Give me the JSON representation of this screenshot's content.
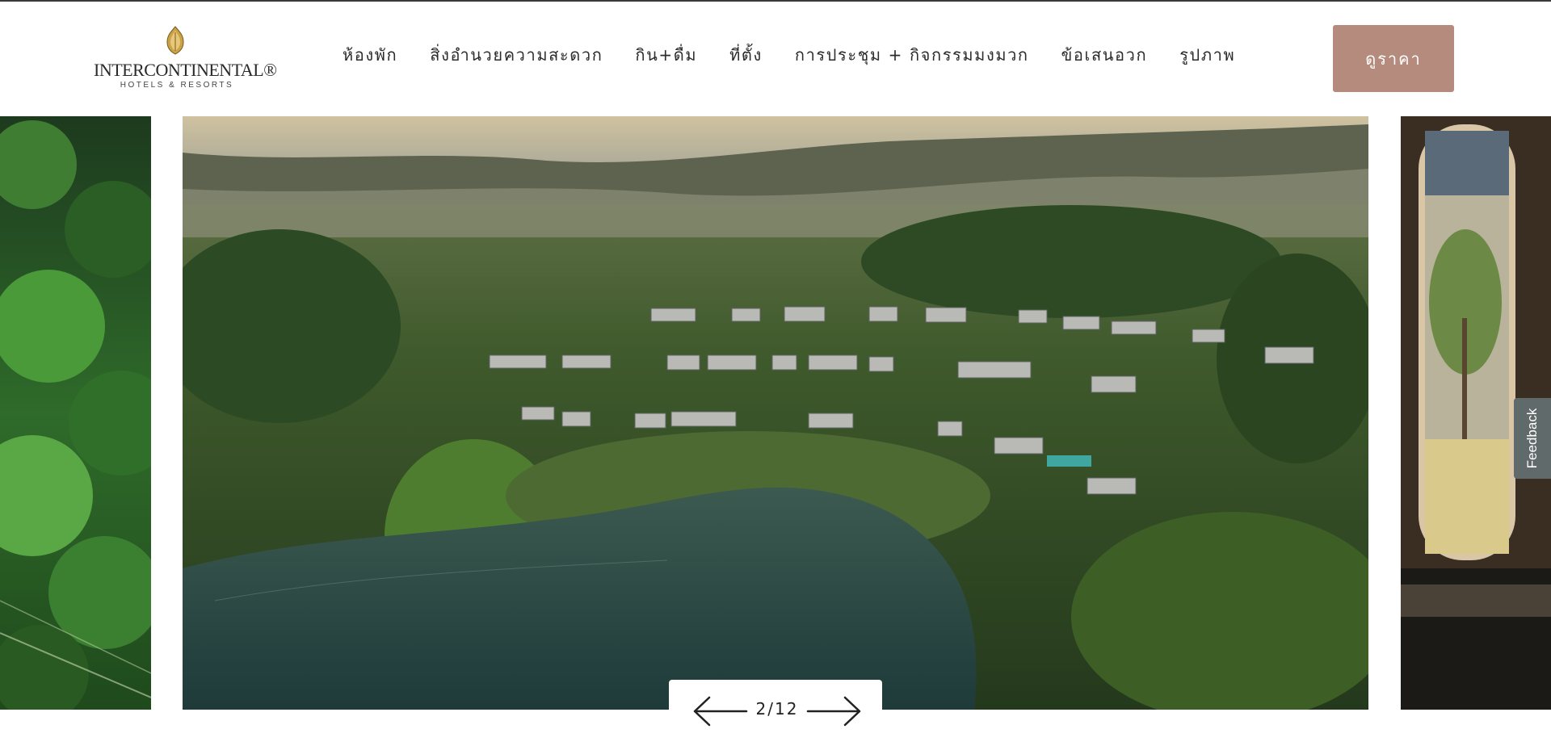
{
  "brand": {
    "wordmark": "INTERCONTINENTAL®",
    "subline": "HOTELS & RESORTS",
    "icon": "crest-icon",
    "accent_color": "#b58b7d"
  },
  "nav": {
    "items": [
      {
        "label": "ห้องพัก"
      },
      {
        "label": "สิ่งอำนวยความสะดวก"
      },
      {
        "label": "กิน+ดื่ม"
      },
      {
        "label": "ที่ตั้ง"
      },
      {
        "label": "การประชุม + กิจกรรมมงมวก"
      },
      {
        "label": "ข้อเสนอวก"
      },
      {
        "label": "รูปภาพ"
      }
    ]
  },
  "cta": {
    "label": "ดูราคา"
  },
  "gallery": {
    "counter": "2/12",
    "prev_icon": "arrow-left-icon",
    "next_icon": "arrow-right-icon"
  },
  "feedback": {
    "label": "Feedback"
  }
}
